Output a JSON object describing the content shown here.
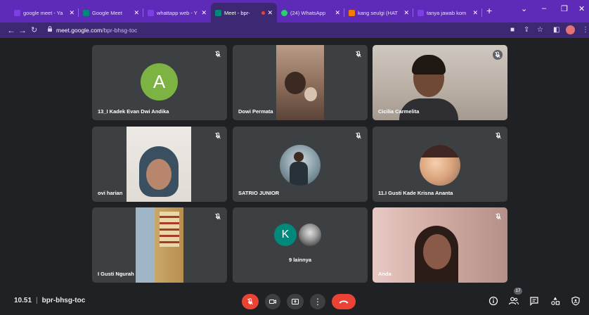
{
  "browser": {
    "tabs": [
      {
        "title": "google meet - Ya",
        "active": false,
        "icon": "yahoo-icon"
      },
      {
        "title": "Google Meet",
        "active": false,
        "icon": "google-meet-icon"
      },
      {
        "title": "whattapp web - Y",
        "active": false,
        "icon": "yahoo-icon"
      },
      {
        "title": "Meet - bpr-",
        "active": true,
        "icon": "google-meet-icon"
      },
      {
        "title": "(24) WhatsApp",
        "active": false,
        "icon": "whatsapp-icon"
      },
      {
        "title": "kang seulgi (HAT",
        "active": false,
        "icon": "webtoon-icon"
      },
      {
        "title": "tanya jawab kom",
        "active": false,
        "icon": "yahoo-icon"
      }
    ],
    "url_domain": "meet.google.com",
    "url_path": "/bpr-bhsg-toc"
  },
  "participants": [
    {
      "name": "13_I Kadek Evan Dwi Andika",
      "avatar_letter": "A",
      "avatar_color": "#7cb342",
      "muted": true
    },
    {
      "name": "Dowi Permata",
      "muted": true
    },
    {
      "name": "Cicilia Carmelita",
      "muted": true
    },
    {
      "name": "ovi harian",
      "muted": true
    },
    {
      "name": "SATRIO JUNIOR",
      "muted": true
    },
    {
      "name": "11.I Gusti Kade Krisna Ananta",
      "muted": true
    },
    {
      "name": "I Gusti Ngurah",
      "muted": true
    },
    {
      "name": "9 lainnya",
      "avatar_letter": "K",
      "avatar_color": "#00897b"
    },
    {
      "name": "Anda",
      "muted": true
    }
  ],
  "meeting": {
    "time": "10.51",
    "code": "bpr-bhsg-toc",
    "participant_count": "17"
  },
  "colors": {
    "tab_strip": "#5e2bb8",
    "meet_bg": "#202124",
    "tile_bg": "#3c4043",
    "end_call": "#ea4335"
  }
}
